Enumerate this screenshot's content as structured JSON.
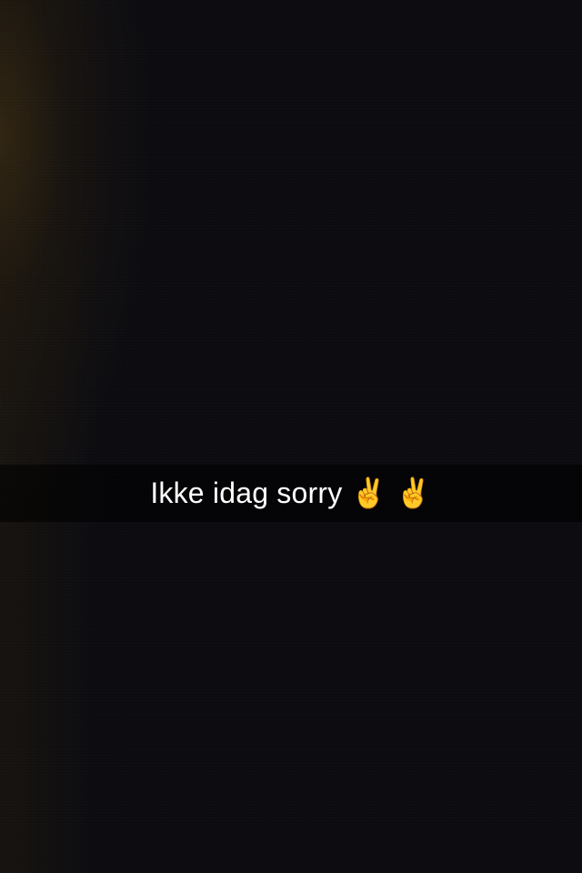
{
  "caption": {
    "text": "Ikke idag sorry ✌️ ✌️"
  },
  "colors": {
    "background": "#0b0b10",
    "caption_bar": "rgba(0,0,0,0.55)",
    "caption_text": "#ffffff"
  }
}
